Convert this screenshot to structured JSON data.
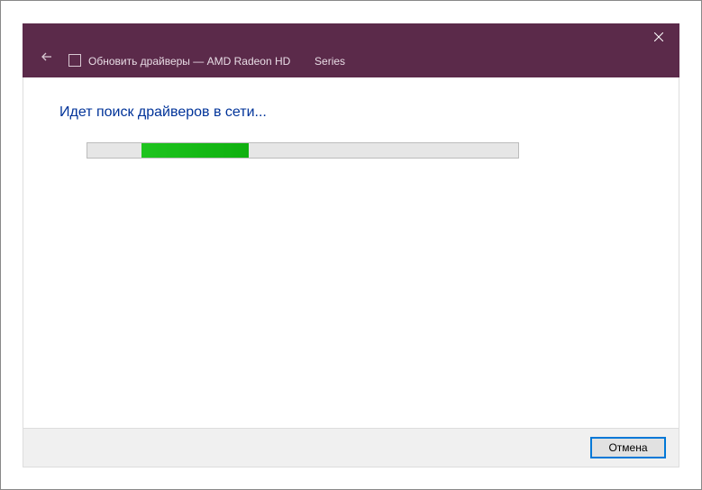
{
  "window": {
    "title_prefix": "Обновить драйверы — AMD Radeon HD",
    "title_suffix": "Series"
  },
  "content": {
    "heading": "Идет поиск драйверов в сети..."
  },
  "progress": {
    "indeterminate_left_pct": "12.5",
    "indeterminate_width_pct": "25"
  },
  "footer": {
    "cancel_label": "Отмена"
  }
}
